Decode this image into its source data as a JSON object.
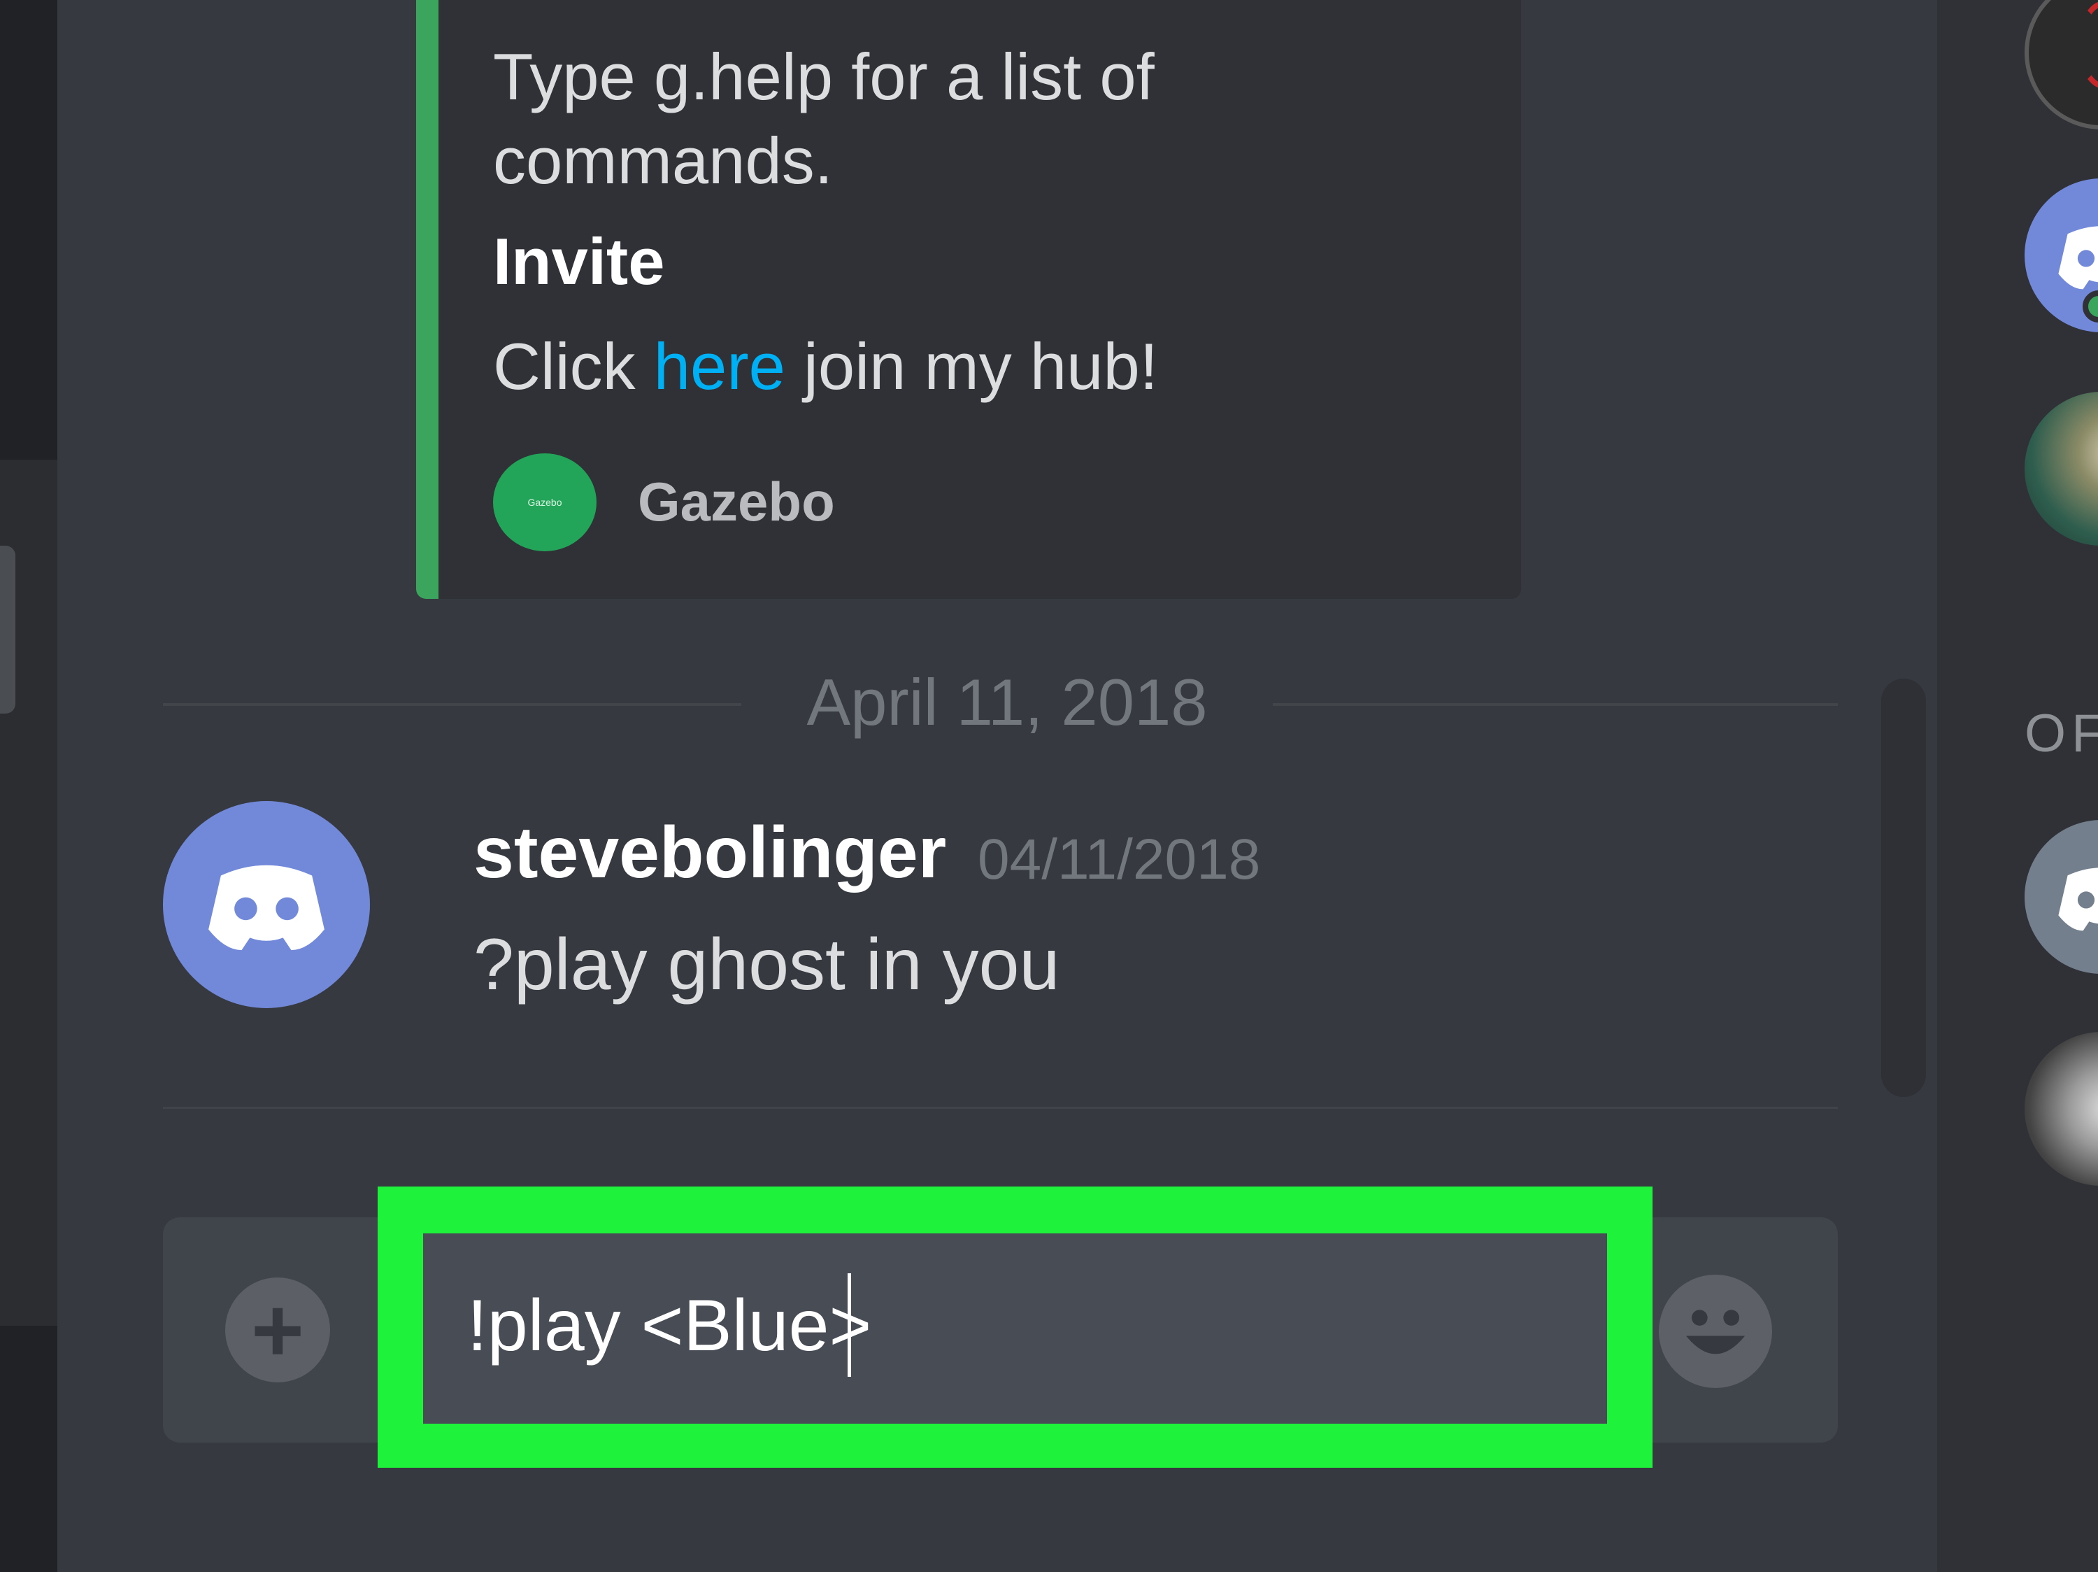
{
  "embed": {
    "help_text": "Type g.help for a list of commands.",
    "title": "Invite",
    "click_prefix": "Click ",
    "link_text": "here",
    "click_suffix": " join my hub!",
    "footer_icon_text": "Gazebo",
    "footer_name": "Gazebo",
    "accent_color": "#3ba55d"
  },
  "divider": {
    "date": "April 11, 2018"
  },
  "message": {
    "author": "stevebolinger",
    "timestamp": "04/11/2018",
    "content": "?play ghost in you",
    "avatar_icon": "discord-logo-icon"
  },
  "composer": {
    "value": "!play <Blue>",
    "attach_symbol": "+",
    "attach_icon": "plus-icon",
    "emoji_icon": "emoji-icon",
    "highlight_color": "#1ef23b"
  },
  "members": {
    "section_header": "OF"
  }
}
